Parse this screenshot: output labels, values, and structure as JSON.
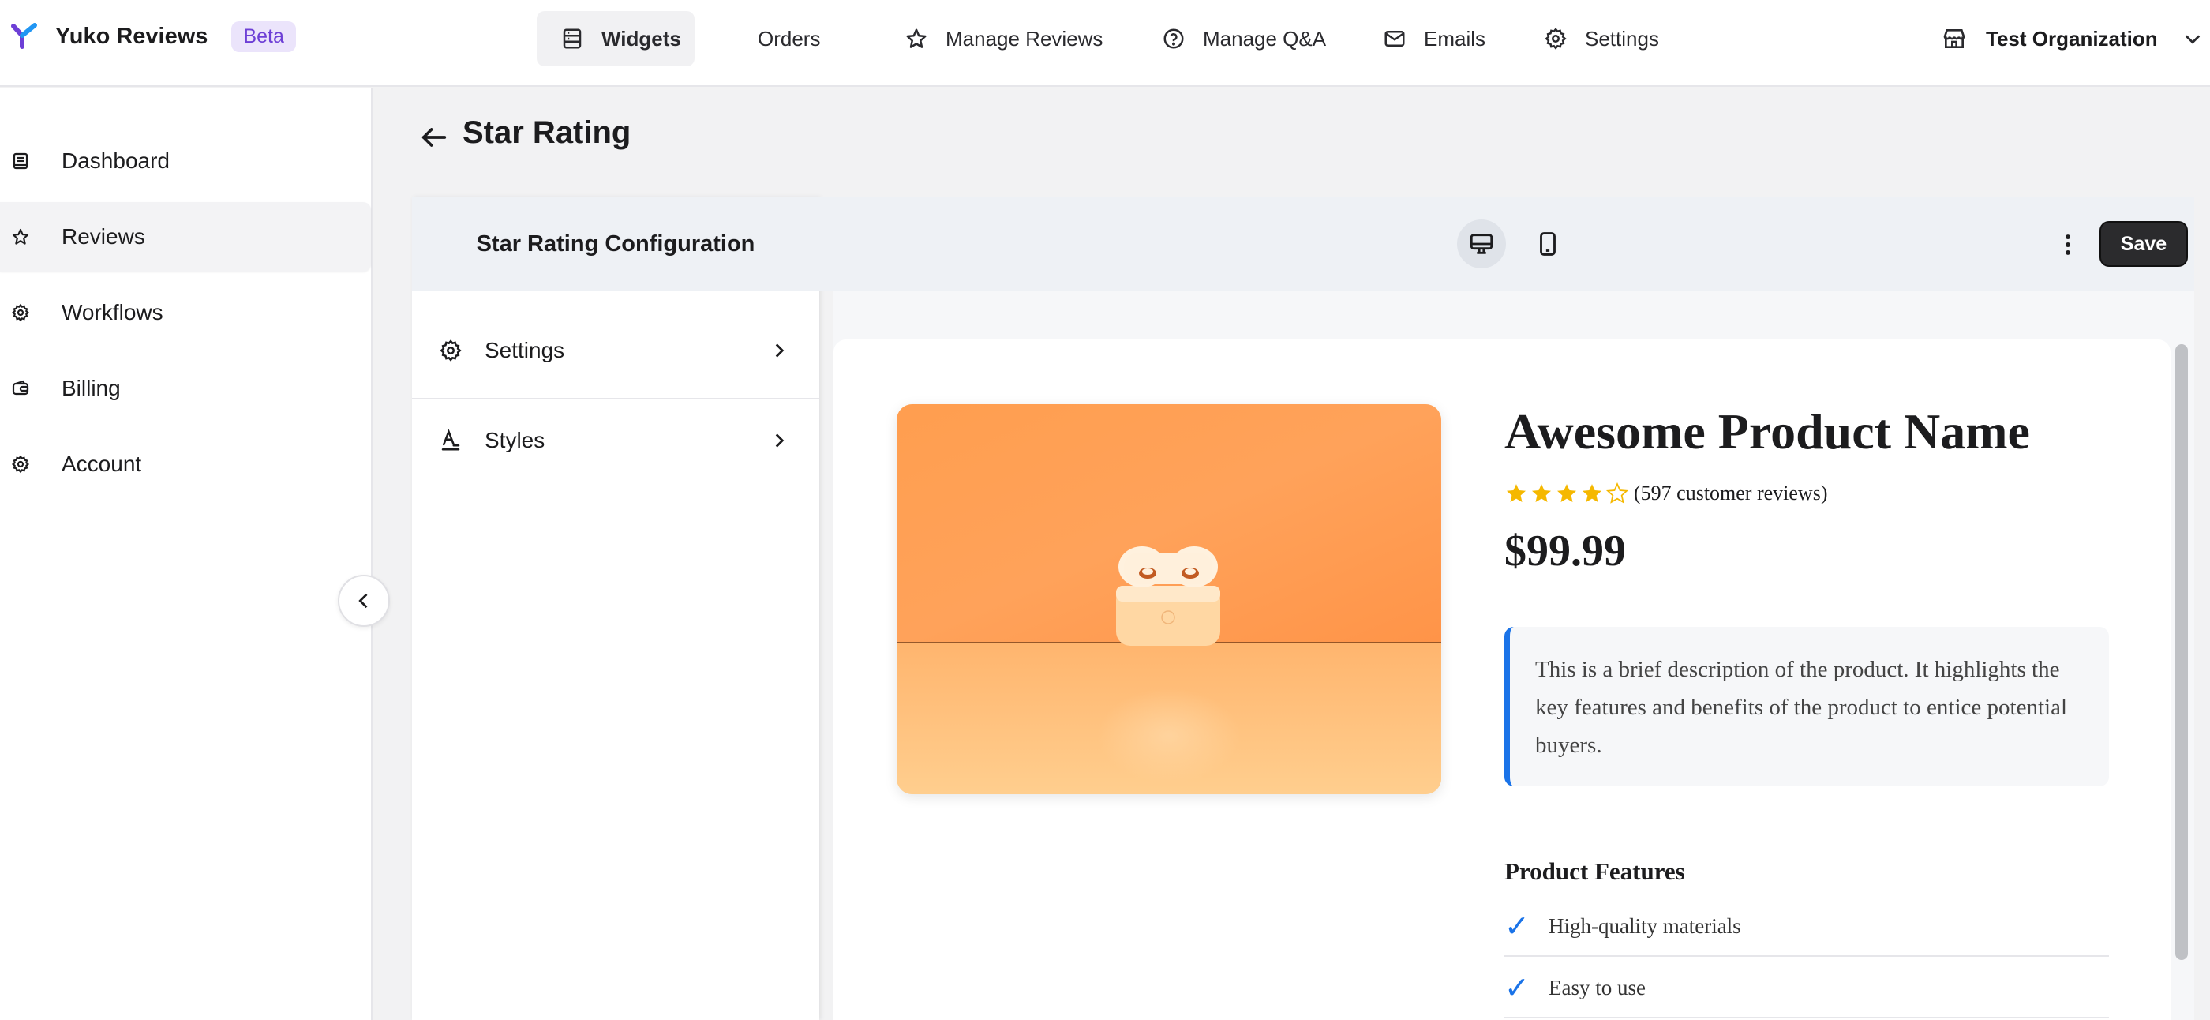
{
  "brand": {
    "name": "Yuko Reviews",
    "badge": "Beta"
  },
  "topnav": {
    "items": [
      {
        "label": "Widgets",
        "icon": "widgets-icon"
      },
      {
        "label": "Orders",
        "icon": "inbox-icon"
      },
      {
        "label": "Manage Reviews",
        "icon": "star-icon"
      },
      {
        "label": "Manage Q&A",
        "icon": "question-icon"
      },
      {
        "label": "Emails",
        "icon": "mail-icon"
      },
      {
        "label": "Settings",
        "icon": "gear-icon"
      }
    ],
    "active": "Widgets",
    "org": "Test Organization"
  },
  "sidebar": {
    "items": [
      {
        "label": "Dashboard",
        "icon": "book-icon"
      },
      {
        "label": "Reviews",
        "icon": "star-icon"
      },
      {
        "label": "Workflows",
        "icon": "gear-icon"
      },
      {
        "label": "Billing",
        "icon": "wallet-icon"
      },
      {
        "label": "Account",
        "icon": "gear-icon"
      }
    ],
    "active": "Reviews"
  },
  "page": {
    "title": "Star Rating"
  },
  "config": {
    "title": "Star Rating Configuration",
    "items": [
      {
        "label": "Settings",
        "icon": "gear-icon"
      },
      {
        "label": "Styles",
        "icon": "text-style-icon"
      }
    ]
  },
  "toolbar": {
    "save_label": "Save",
    "active_device": "desktop"
  },
  "product": {
    "name": "Awesome Product Name",
    "rating": 4,
    "rating_max": 5,
    "review_count": "(597 customer reviews)",
    "price": "$99.99",
    "description": "This is a brief description of the product. It highlights the key features and benefits of the product to entice potential buyers.",
    "features_title": "Product Features",
    "features": [
      "High-quality materials",
      "Easy to use"
    ]
  },
  "colors": {
    "accent": "#1a73e8",
    "star": "#f5b800",
    "brand_purple": "#6d3fd6",
    "save_bg": "#2b2b2d"
  }
}
